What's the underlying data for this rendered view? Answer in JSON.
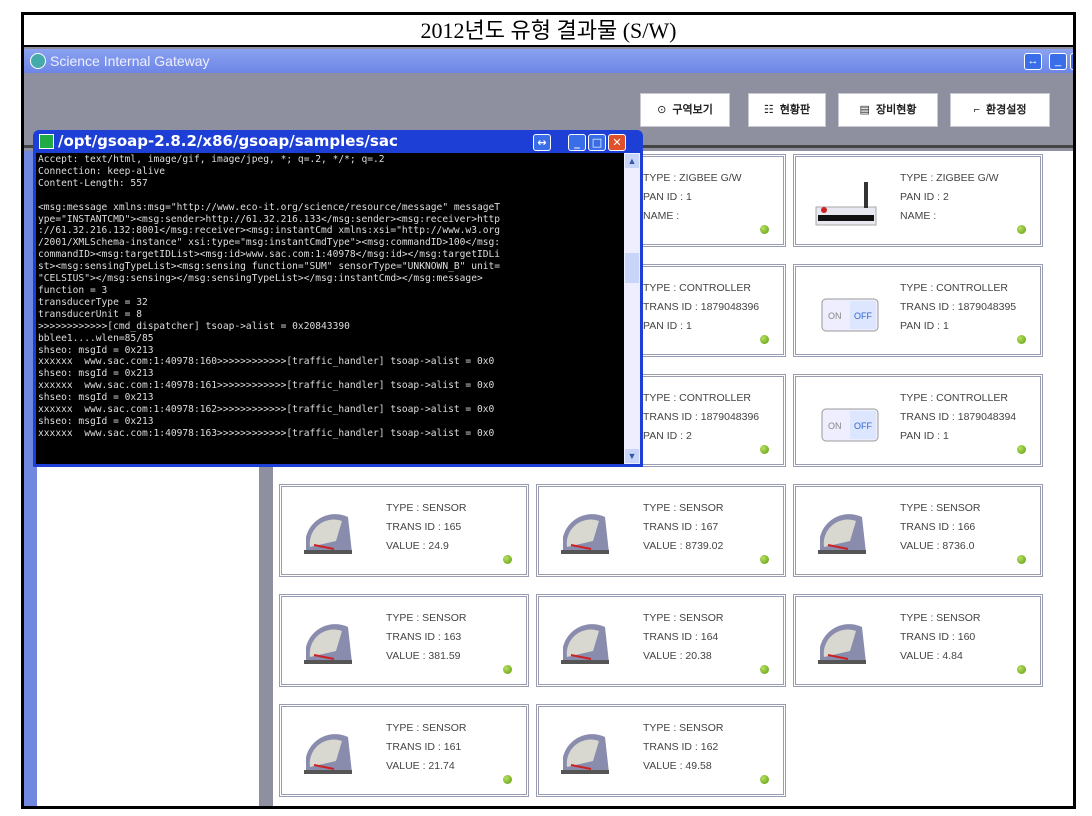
{
  "doc_title": "2012년도 유형 결과물 (S/W)",
  "app": {
    "title": "Science Internal Gateway"
  },
  "toolbar": [
    {
      "icon": "map-pin-icon",
      "glyph": "⊙",
      "label": "구역보기"
    },
    {
      "icon": "list-icon",
      "glyph": "☷",
      "label": "현황판"
    },
    {
      "icon": "document-icon",
      "glyph": "▤",
      "label": "장비현황"
    },
    {
      "icon": "settings-icon",
      "glyph": "⌐",
      "label": "환경설정"
    }
  ],
  "terminal": {
    "title": "/opt/gsoap-2.8.2/x86/gsoap/samples/sac",
    "lines": [
      "Accept: text/html, image/gif, image/jpeg, *; q=.2, */*; q=.2",
      "Connection: keep-alive",
      "Content-Length: 557",
      "",
      "<msg:message xmlns:msg=\"http://www.eco-it.org/science/resource/message\" messageT",
      "ype=\"INSTANTCMD\"><msg:sender>http://61.32.216.133</msg:sender><msg:receiver>http",
      "://61.32.216.132:8001</msg:receiver><msg:instantCmd xmlns:xsi=\"http://www.w3.org",
      "/2001/XMLSchema-instance\" xsi:type=\"msg:instantCmdType\"><msg:commandID>100</msg:",
      "commandID><msg:targetIDList><msg:id>www.sac.com:1:40978</msg:id></msg:targetIDLi",
      "st><msg:sensingTypeList><msg:sensing function=\"SUM\" sensorType=\"UNKNOWN_B\" unit=",
      "\"CELSIUS\"></msg:sensing></msg:sensingTypeList></msg:instantCmd></msg:message>",
      "function = 3",
      "transducerType = 32",
      "transducerUnit = 8",
      ">>>>>>>>>>>>[cmd_dispatcher] tsoap->alist = 0x20843390",
      "bblee1....wlen=85/85",
      "shseo: msgId = 0x213",
      "xxxxxx  www.sac.com:1:40978:160>>>>>>>>>>>>[traffic_handler] tsoap->alist = 0x0",
      "shseo: msgId = 0x213",
      "xxxxxx  www.sac.com:1:40978:161>>>>>>>>>>>>[traffic_handler] tsoap->alist = 0x0",
      "shseo: msgId = 0x213",
      "xxxxxx  www.sac.com:1:40978:162>>>>>>>>>>>>[traffic_handler] tsoap->alist = 0x0",
      "shseo: msgId = 0x213",
      "xxxxxx  www.sac.com:1:40978:163>>>>>>>>>>>>[traffic_handler] tsoap->alist = 0x0"
    ]
  },
  "cards": [
    {
      "kind": "gateway",
      "lines": [
        "TYPE : ZIGBEE G/W",
        "PAN  ID : 1",
        "NAME :"
      ]
    },
    {
      "kind": "gateway",
      "lines": [
        "TYPE : ZIGBEE G/W",
        "PAN  ID : 2",
        "NAME :"
      ]
    },
    {
      "kind": "controller",
      "lines": [
        "TYPE : CONTROLLER",
        "TRANS  ID : 1879048396",
        "PAN ID : 1"
      ]
    },
    {
      "kind": "controller",
      "lines": [
        "TYPE : CONTROLLER",
        "TRANS  ID : 1879048395",
        "PAN ID : 1"
      ]
    },
    {
      "kind": "controller",
      "lines": [
        "TYPE : CONTROLLER",
        "TRANS  ID : 1879048396",
        "PAN ID : 2"
      ]
    },
    {
      "kind": "controller",
      "lines": [
        "TYPE : CONTROLLER",
        "TRANS  ID : 1879048394",
        "PAN ID : 1"
      ]
    },
    {
      "kind": "sensor",
      "lines": [
        "TYPE : SENSOR",
        "TRANS  ID : 165",
        "VALUE : 24.9"
      ]
    },
    {
      "kind": "sensor",
      "lines": [
        "TYPE : SENSOR",
        "TRANS  ID : 167",
        "VALUE : 8739.02"
      ]
    },
    {
      "kind": "sensor",
      "lines": [
        "TYPE : SENSOR",
        "TRANS  ID : 166",
        "VALUE : 8736.0"
      ]
    },
    {
      "kind": "sensor",
      "lines": [
        "TYPE : SENSOR",
        "TRANS  ID : 163",
        "VALUE : 381.59"
      ]
    },
    {
      "kind": "sensor",
      "lines": [
        "TYPE : SENSOR",
        "TRANS  ID : 164",
        "VALUE : 20.38"
      ]
    },
    {
      "kind": "sensor",
      "lines": [
        "TYPE : SENSOR",
        "TRANS  ID : 160",
        "VALUE : 4.84"
      ]
    },
    {
      "kind": "sensor",
      "lines": [
        "TYPE : SENSOR",
        "TRANS  ID : 161",
        "VALUE : 21.74"
      ]
    },
    {
      "kind": "sensor",
      "lines": [
        "TYPE : SENSOR",
        "TRANS  ID : 162",
        "VALUE : 49.58"
      ]
    }
  ],
  "switch": {
    "on": "ON",
    "off": "OFF"
  },
  "status_color": "#6aaa1a"
}
